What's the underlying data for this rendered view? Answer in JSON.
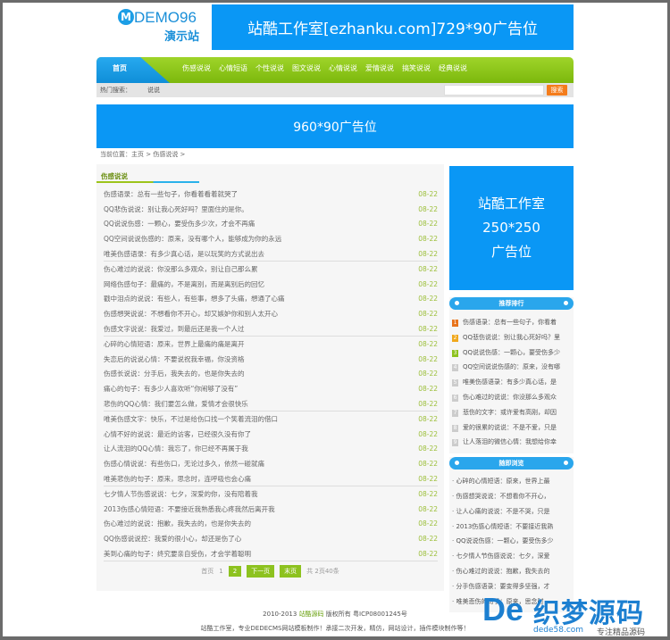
{
  "logo": {
    "text": "DEMO96",
    "sub": "演示站",
    "mark": "M"
  },
  "top_banner": "站酷工作室[ezhanku.com]729*90广告位",
  "nav": {
    "home": "首页",
    "items": [
      "伤感说说",
      "心情短语",
      "个性说说",
      "图文说说",
      "心情说说",
      "爱情说说",
      "搞笑说说",
      "经典说说"
    ]
  },
  "hot": {
    "label": "热门搜索：",
    "keyword": "说说",
    "search_button": "搜索",
    "search_value": ""
  },
  "big_banner": "960*90广告位",
  "breadcrumb": "当前位置：主页 > 伤感说说 >",
  "list": {
    "title": "伤感说说",
    "items": [
      {
        "t": "伤感语录：总有一些句子，你看着看着就哭了",
        "d": "08-22"
      },
      {
        "t": "QQ悲伤说说：别让我心死好吗？里面住的是你。",
        "d": "08-22"
      },
      {
        "t": "QQ说说伤感：一颗心，要受伤多少次，才会不再痛",
        "d": "08-22"
      },
      {
        "t": "QQ空间说说伤感的：原来，没有哪个人，能够成为你的永远",
        "d": "08-22"
      },
      {
        "t": "唯美伤感语录：有多少真心话，是以玩笑的方式说出去",
        "d": "08-22"
      },
      {
        "t": "伤心难过的说说：你没那么多观众，别让自己那么累",
        "d": "08-22"
      },
      {
        "t": "网络伤感句子：最痛的，不是离别，而是离别后的回忆",
        "d": "08-22"
      },
      {
        "t": "戳中泪点的说说：有些人，有些事，想多了头痛，想通了心痛",
        "d": "08-22"
      },
      {
        "t": "伤感想哭说说：不想看你不开心，却又嫉妒你和别人太开心",
        "d": "08-22"
      },
      {
        "t": "伤感文字说说：我爱过，到最后还是我一个人过",
        "d": "08-22"
      },
      {
        "t": "心碎的心情短语：原来，世界上最痛的痛是离开",
        "d": "08-22"
      },
      {
        "t": "失恋后的说说心情：不要说祝我幸福，你没资格",
        "d": "08-22"
      },
      {
        "t": "伤感长说说：分手后，我失去的，也是你失去的",
        "d": "08-22"
      },
      {
        "t": "痛心的句子：有多少人喜欢听“你闹够了没有”",
        "d": "08-22"
      },
      {
        "t": "悲伤的QQ心情：我们要怎么做，爱情才会很快乐",
        "d": "08-22"
      },
      {
        "t": "唯美伤感文字：快乐，不过是给伤口找一个笑着流泪的借口",
        "d": "08-22"
      },
      {
        "t": "心情不好的说说：最近的访客，已经很久没有你了",
        "d": "08-22"
      },
      {
        "t": "让人流泪的QQ心情：我忘了，你已经不再属于我",
        "d": "08-22"
      },
      {
        "t": "伤感心情说说：有些伤口，无论过多久，依然一碰就痛",
        "d": "08-22"
      },
      {
        "t": "唯美悲伤的句子：原来，思念时，连呼吸也会心痛",
        "d": "08-22"
      },
      {
        "t": "七夕情人节伤感说说：七夕，深爱的你，没有陪着我",
        "d": "08-22"
      },
      {
        "t": "2013伤感心情短语：不要接近我熟悉我心疼我然后离开我",
        "d": "08-22"
      },
      {
        "t": "伤心难过的说说：抱歉，我失去的，也是你失去的",
        "d": "08-22"
      },
      {
        "t": "QQ伤感说说控：我爱的很小心，却还是伤了心",
        "d": "08-22"
      },
      {
        "t": "美到心痛的句子：终究要亲自受伤，才会学着聪明",
        "d": "08-22"
      }
    ]
  },
  "pager": {
    "first": "首页",
    "p1": "1",
    "current": "2",
    "next": "下一页",
    "last": "末页",
    "total": "共 2页40条"
  },
  "side_ad": {
    "l1": "站酷工作室",
    "l2": "250*250",
    "l3": "广告位"
  },
  "rank": {
    "title": "推荐排行",
    "items": [
      "伤感语录：总有一些句子，你看着",
      "QQ悲伤说说：别让我心死好吗？里",
      "QQ说说伤感：一颗心，要受伤多少",
      "QQ空间说说伤感的：原来，没有哪",
      "唯美伤感语录：有多少真心话，是",
      "伤心难过的说说：你没那么多观众",
      "悲伤的文字：或许爱有高刚，却因",
      "爱的很累的说说：不是不爱，只是",
      "让人落泪的微信心情：我想给你幸"
    ],
    "colors": [
      "#e8731a",
      "#f0a81c",
      "#8dc21f",
      "#ccc",
      "#ccc",
      "#ccc",
      "#ccc",
      "#ccc",
      "#ccc"
    ]
  },
  "random": {
    "title": "随即浏览",
    "items": [
      "心碎的心情短语：原来，世界上最",
      "伤感想哭说说：不想看你不开心，",
      "让人心痛的说说：不是不哭，只是",
      "2013伤感心情短语：不要接近我熟",
      "QQ说说伤感：一颗心，要受伤多少",
      "七夕情人节伤感说说：七夕，深爱",
      "伤心难过的说说：抱歉，我失去的",
      "分手伤感语录：要变得多坚强，才",
      "唯美悲伤的句子：原来，思念时"
    ]
  },
  "footer": {
    "copy_pre": "2010-2013",
    "brand": "站酷源码",
    "copy_post": "版权所有 粤ICP08001245号",
    "line2": "站酷工作室，专业DEDECMS网站模板制作！承接二次开发，精仿，网站设计，插件模块制作等！"
  },
  "watermark": {
    "logo": "De",
    "name": "织梦源码",
    "site": "dede58.com",
    "slogan": "专注精品源码"
  }
}
